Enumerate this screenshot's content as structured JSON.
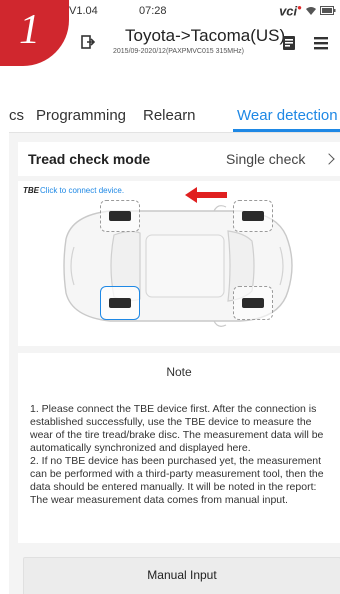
{
  "badge": {
    "number": "1"
  },
  "status_bar": {
    "version": "V1.04",
    "time": "07:28",
    "vci_label": "vci"
  },
  "header": {
    "title": "Toyota->Tacoma(US)",
    "subtitle": "2015/09-2020/12(PAXPMVC015 315MHz)"
  },
  "tabs": [
    {
      "label": "cs",
      "active": false
    },
    {
      "label": "Programming",
      "active": false
    },
    {
      "label": "Relearn",
      "active": false
    },
    {
      "label": "Wear detection",
      "active": true
    }
  ],
  "tread_check": {
    "label": "Tread check mode",
    "value": "Single check"
  },
  "diagram": {
    "tbe_label": "TBE",
    "connect_text": "Click to connect device.",
    "selected_tire": "rear-left"
  },
  "note": {
    "title": "Note",
    "paragraph1": "1. Please connect the TBE device first. After the connection is established successfully, use the TBE device to measure the wear of the tire tread/brake disc. The measurement data will be automatically synchronized and displayed here.",
    "paragraph2": " 2. If no TBE device has been purchased yet, the measurement can be performed with a third-party measurement tool, then the data should be entered manually. It will be noted in the report: The wear measurement data comes from manual input."
  },
  "manual_input": {
    "label": "Manual Input"
  },
  "colors": {
    "accent": "#1e88e5",
    "badge": "#d0272e",
    "arrow": "#e02020"
  }
}
